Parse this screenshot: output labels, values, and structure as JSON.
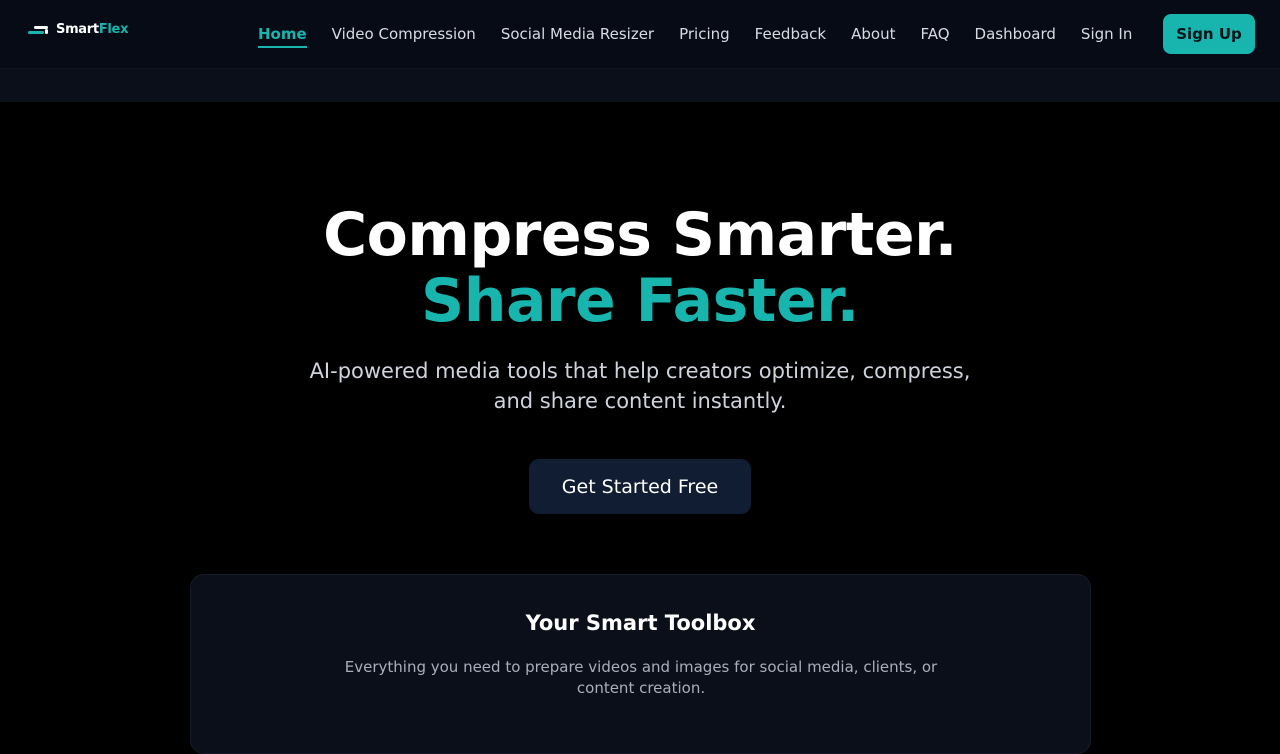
{
  "brand": {
    "name_part1": "Smart",
    "name_part2": "Flex",
    "accent_color": "#17b5ad"
  },
  "nav": {
    "items": [
      {
        "label": "Home",
        "active": true
      },
      {
        "label": "Video Compression",
        "active": false
      },
      {
        "label": "Social Media Resizer",
        "active": false
      },
      {
        "label": "Pricing",
        "active": false
      },
      {
        "label": "Feedback",
        "active": false
      },
      {
        "label": "About",
        "active": false
      },
      {
        "label": "FAQ",
        "active": false
      },
      {
        "label": "Dashboard",
        "active": false
      },
      {
        "label": "Sign In",
        "active": false
      }
    ],
    "signup_label": "Sign Up"
  },
  "hero": {
    "headline_line1": "Compress Smarter.",
    "headline_line2": "Share Faster.",
    "subtitle": "AI-powered media tools that help creators optimize, compress, and share content instantly.",
    "cta_label": "Get Started Free"
  },
  "toolbox": {
    "title": "Your Smart Toolbox",
    "description": "Everything you need to prepare videos and images for social media, clients, or content creation."
  },
  "icons": {
    "logo": "speed-lines-icon"
  }
}
